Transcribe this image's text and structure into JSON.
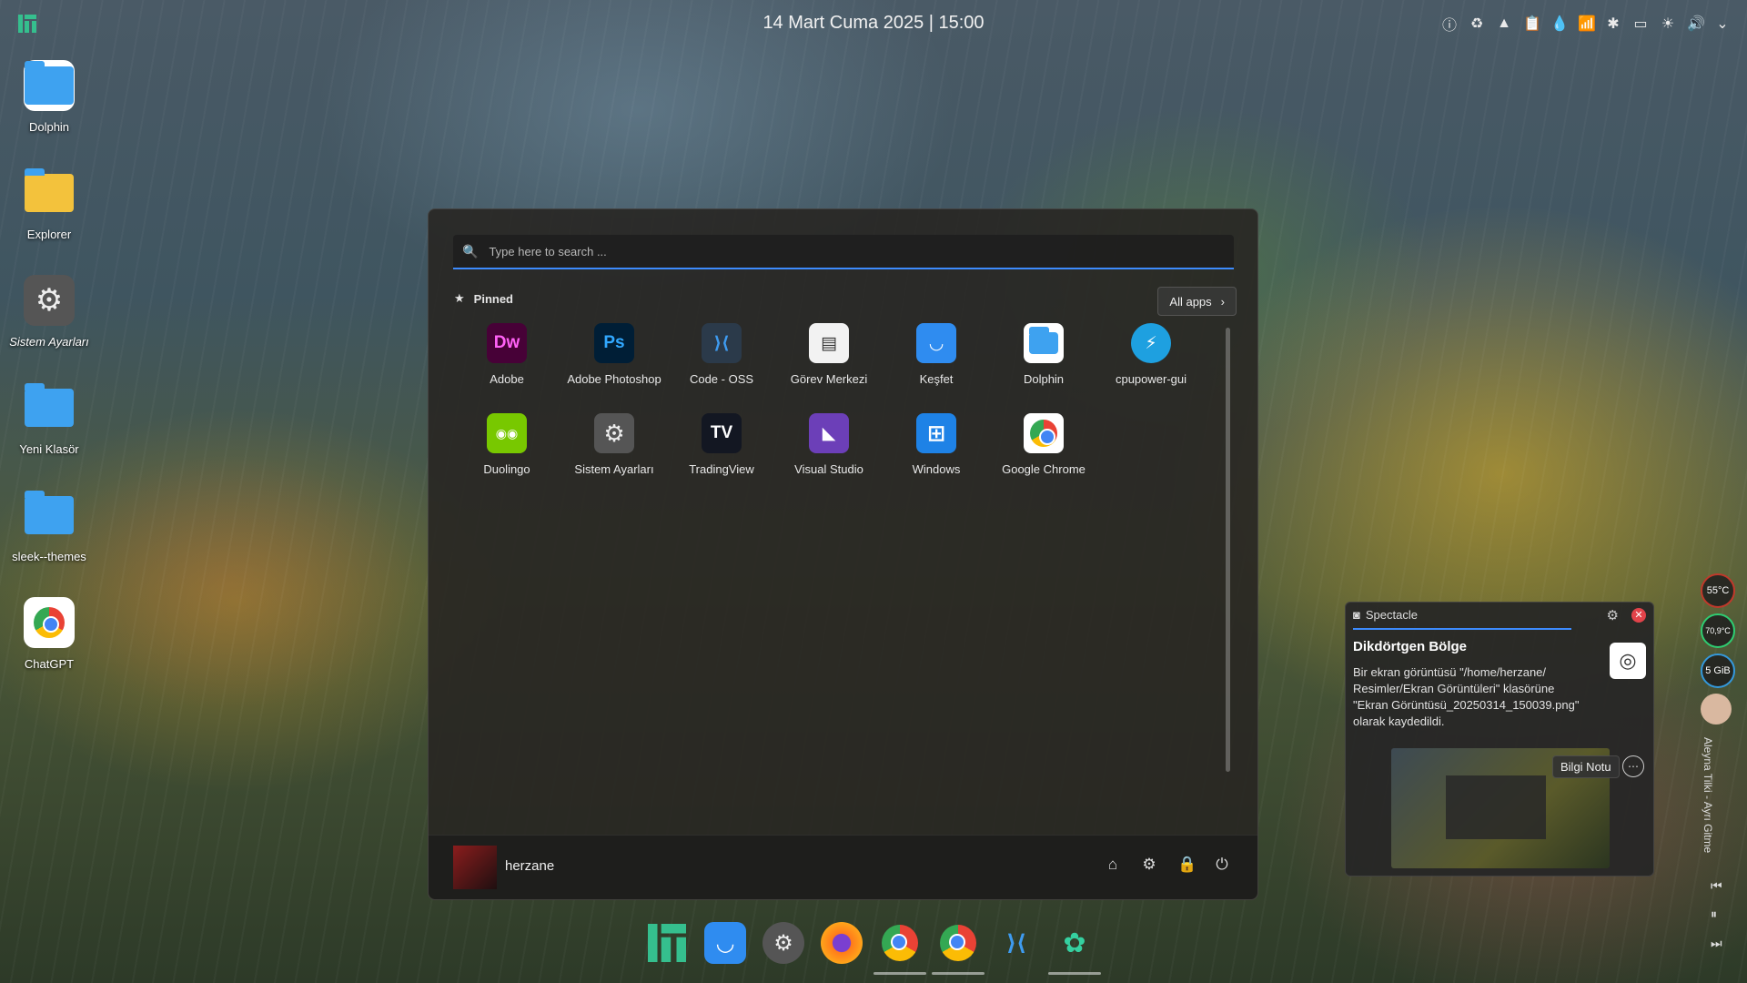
{
  "topbar": {
    "datetime": "14 Mart Cuma 2025 | 15:00",
    "tray_icons": [
      "info-icon",
      "sync-icon",
      "arch-icon",
      "clipboard-icon",
      "drop-icon",
      "wifi-icon",
      "bluetooth-icon",
      "battery-icon",
      "brightness-icon",
      "volume-icon",
      "chevron-down-icon"
    ]
  },
  "desktop": {
    "icons": [
      {
        "label": "Dolphin",
        "icon": "folder-icon"
      },
      {
        "label": "Explorer",
        "icon": "explorer-folder-icon"
      },
      {
        "label": "Sistem Ayarları",
        "icon": "settings-icon"
      },
      {
        "label": "Yeni Klasör",
        "icon": "folder-icon"
      },
      {
        "label": "sleek--themes",
        "icon": "folder-icon"
      },
      {
        "label": "ChatGPT",
        "icon": "chrome-icon"
      }
    ]
  },
  "menu": {
    "search_placeholder": "Type here to search ...",
    "pinned_label": "Pinned",
    "all_apps_label": "All apps",
    "apps": [
      {
        "label": "Adobe",
        "glyph": "Dw",
        "bg": "#470137",
        "fg": "#ff61f6"
      },
      {
        "label": "Adobe Photoshop",
        "glyph": "Ps",
        "bg": "#001e36",
        "fg": "#31a8ff"
      },
      {
        "label": "Code - OSS",
        "glyph": "⟩⟨",
        "bg": "#2b3a4a",
        "fg": "#3e9bf0"
      },
      {
        "label": "Görev Merkezi",
        "glyph": "▤",
        "bg": "#f2f2f2",
        "fg": "#333333"
      },
      {
        "label": "Keşfet",
        "glyph": "◡",
        "bg": "#2f8cf0",
        "fg": "#ffffff"
      },
      {
        "label": "Dolphin",
        "glyph": "▭",
        "bg": "#ffffff",
        "fg": "#3ea2f0"
      },
      {
        "label": "cpupower-gui",
        "glyph": "⚡",
        "bg": "#1ea0e0",
        "fg": "#ffffff"
      },
      {
        "label": "Duolingo",
        "glyph": "◉◉",
        "bg": "#78c800",
        "fg": "#ffffff"
      },
      {
        "label": "Sistem Ayarları",
        "glyph": "⚙",
        "bg": "#555555",
        "fg": "#eeeeee"
      },
      {
        "label": "TradingView",
        "glyph": "TV",
        "bg": "#131722",
        "fg": "#ffffff"
      },
      {
        "label": "Visual Studio",
        "glyph": "◣",
        "bg": "#6c3fb8",
        "fg": "#ffffff"
      },
      {
        "label": "Windows",
        "glyph": "⊞",
        "bg": "#1e82e6",
        "fg": "#ffffff"
      },
      {
        "label": "Google Chrome",
        "glyph": "chrome",
        "bg": "#ffffff",
        "fg": "#4285f4"
      }
    ],
    "user_name": "herzane",
    "footer_icons": [
      "home-icon",
      "settings-icon",
      "lock-icon",
      "power-icon"
    ]
  },
  "notification": {
    "app": "Spectacle",
    "title": "Dikdörtgen Bölge",
    "body": "Bir ekran görüntüsü \"/home/herzane/ Resimler/Ekran Görüntüleri\" klasörüne \"Ekran Görüntüsü_20250314_150039.png\" olarak kaydedildi.",
    "info_button": "Bilgi Notu"
  },
  "widgets": {
    "cpu_temp": "55°C",
    "gpu_temp": "70,9°C",
    "memory": "5 GiB",
    "now_playing": "Aleyna Tilki - Ayrı Gitme"
  },
  "dock": {
    "items": [
      "manjaro-icon",
      "discover-icon",
      "settings-icon",
      "firefox-icon",
      "chrome-icon",
      "chrome-icon",
      "vscode-icon",
      "chatgpt-icon"
    ]
  }
}
